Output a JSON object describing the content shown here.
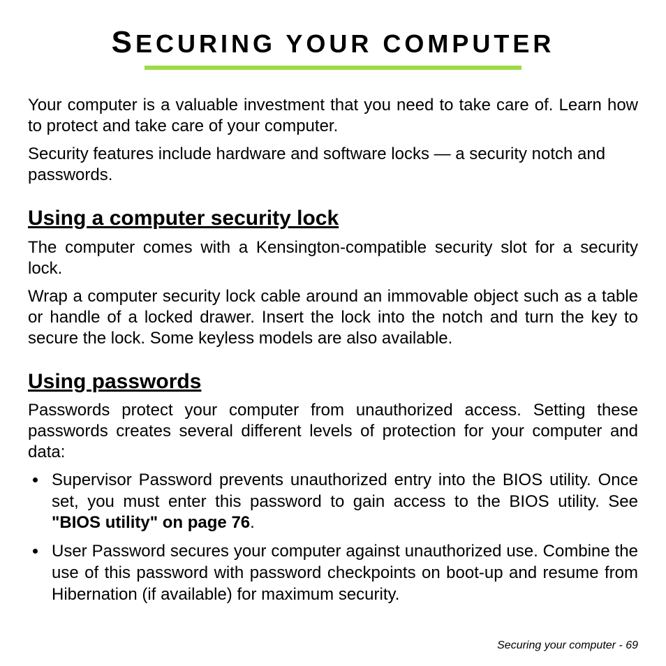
{
  "title": {
    "first_letter": "S",
    "rest": "ECURING YOUR COMPUTER"
  },
  "intro": {
    "p1": "Your computer is a valuable investment that you need to take care of. Learn how to protect and take care of your computer.",
    "p2": "Security features include hardware and software locks — a security notch and passwords."
  },
  "section1": {
    "heading": "Using a computer security lock",
    "p1": "The computer comes with a Kensington-compatible security slot for a security lock.",
    "p2": "Wrap a computer security lock cable around an immovable object such as a table or handle of a locked drawer. Insert the lock into the notch and turn the key to secure the lock. Some keyless models are also available."
  },
  "section2": {
    "heading": "Using passwords",
    "p1": "Passwords protect your computer from unauthorized access. Setting these passwords creates several different levels of protection for your computer and data:",
    "bullets": [
      {
        "pre": "Supervisor Password prevents unauthorized entry into the BIOS utility. Once set, you must enter this password to gain access to the BIOS utility. See ",
        "bold": "\"BIOS utility\" on page 76",
        "post": "."
      },
      {
        "pre": "User Password secures your computer against unauthorized use. Combine the use of this password with password checkpoints on boot-up and resume from Hibernation (if available) for maximum security.",
        "bold": "",
        "post": ""
      }
    ]
  },
  "footer": {
    "text": "Securing your computer -  69"
  }
}
